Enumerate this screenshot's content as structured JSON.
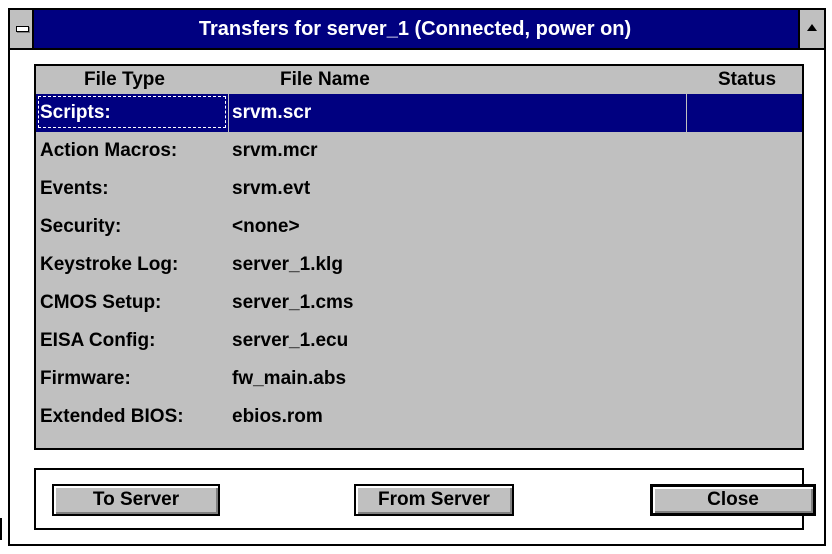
{
  "window": {
    "title": "Transfers for server_1 (Connected, power on)"
  },
  "list": {
    "columns": {
      "file_type": "File Type",
      "file_name": "File Name",
      "status": "Status"
    },
    "rows": [
      {
        "type": "Scripts:",
        "name": "srvm.scr",
        "status": "",
        "selected": true
      },
      {
        "type": "Action Macros:",
        "name": "srvm.mcr",
        "status": ""
      },
      {
        "type": "Events:",
        "name": "srvm.evt",
        "status": ""
      },
      {
        "type": "Security:",
        "name": "<none>",
        "status": ""
      },
      {
        "type": "Keystroke Log:",
        "name": "server_1.klg",
        "status": ""
      },
      {
        "type": "CMOS Setup:",
        "name": "server_1.cms",
        "status": ""
      },
      {
        "type": "EISA Config:",
        "name": "server_1.ecu",
        "status": ""
      },
      {
        "type": "Firmware:",
        "name": "fw_main.abs",
        "status": ""
      },
      {
        "type": "Extended BIOS:",
        "name": "ebios.rom",
        "status": ""
      }
    ]
  },
  "buttons": {
    "to_server": "To Server",
    "from_server": "From Server",
    "close": "Close"
  },
  "colors": {
    "titlebar": "#000080",
    "selection": "#000080",
    "face": "#c0c0c0"
  },
  "icons": {
    "system_menu": "system-menu-icon",
    "maximize": "maximize-arrow-icon"
  }
}
